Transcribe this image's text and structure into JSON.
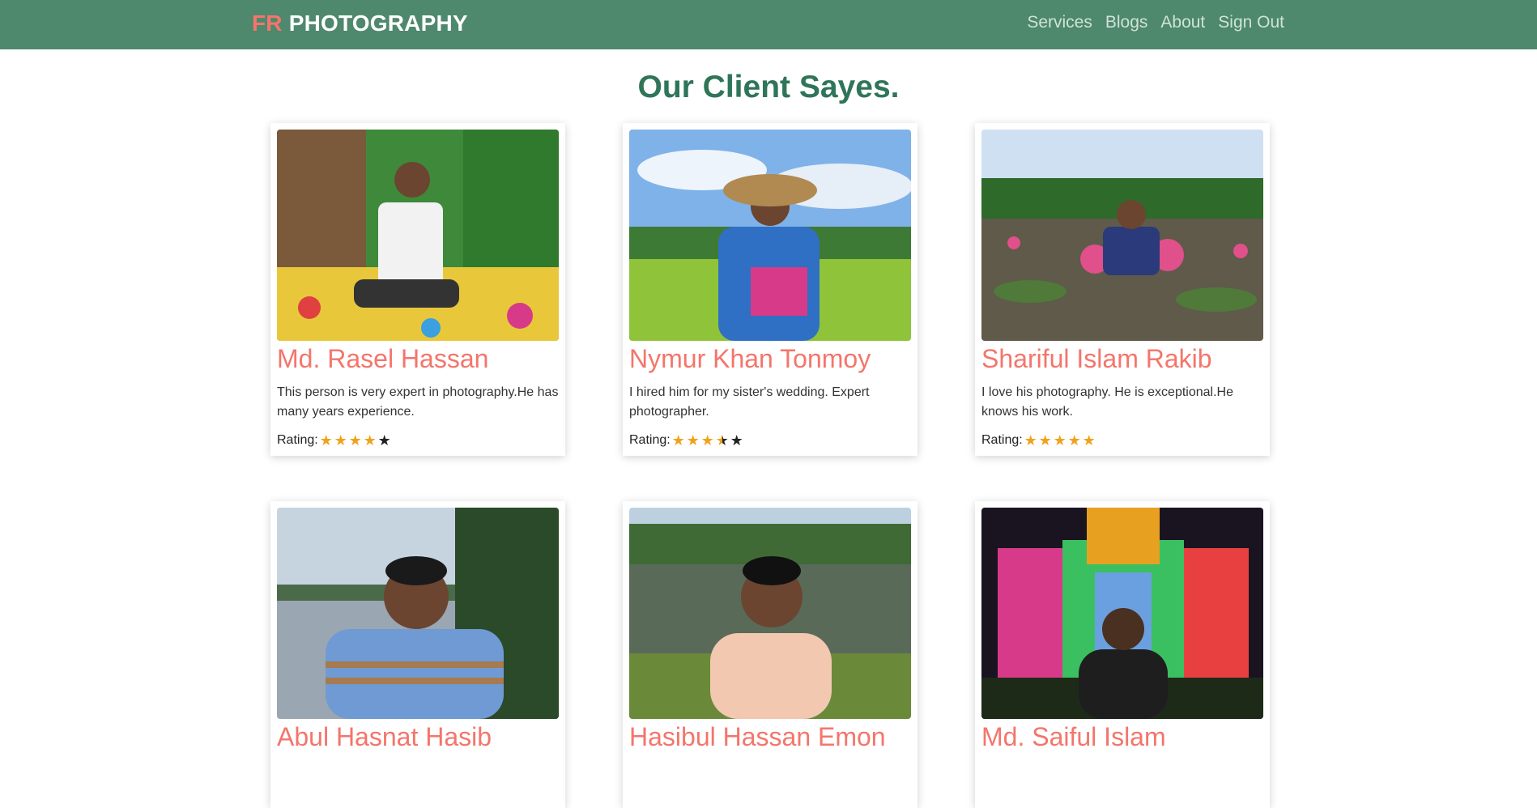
{
  "brand": {
    "accent": "FR",
    "rest": "PHOTOGRAPHY"
  },
  "nav": {
    "items": [
      "Services",
      "Blogs",
      "About",
      "Sign Out"
    ]
  },
  "heading": "Our Client Sayes.",
  "colors": {
    "navbar": "#4e886d",
    "accent": "#f4756b",
    "heading": "#2f7558",
    "star": "#f0a21a"
  },
  "reviews": [
    {
      "name": "Md. Rasel Hassan",
      "text": "This person is very expert in photography.He has many years experience.",
      "rating_label": "Rating:",
      "rating": 4
    },
    {
      "name": "Nymur Khan Tonmoy",
      "text": "I hired him for my sister's wedding. Expert photographer.",
      "rating_label": "Rating:",
      "rating": 3.5
    },
    {
      "name": "Shariful Islam Rakib",
      "text": "I love his photography. He is exceptional.He knows his work.",
      "rating_label": "Rating:",
      "rating": 5
    },
    {
      "name": "Abul Hasnat Hasib",
      "text": "",
      "rating_label": "",
      "rating": null
    },
    {
      "name": "Hasibul Hassan Emon",
      "text": "",
      "rating_label": "",
      "rating": null
    },
    {
      "name": "Md. Saiful Islam",
      "text": "",
      "rating_label": "",
      "rating": null
    }
  ]
}
